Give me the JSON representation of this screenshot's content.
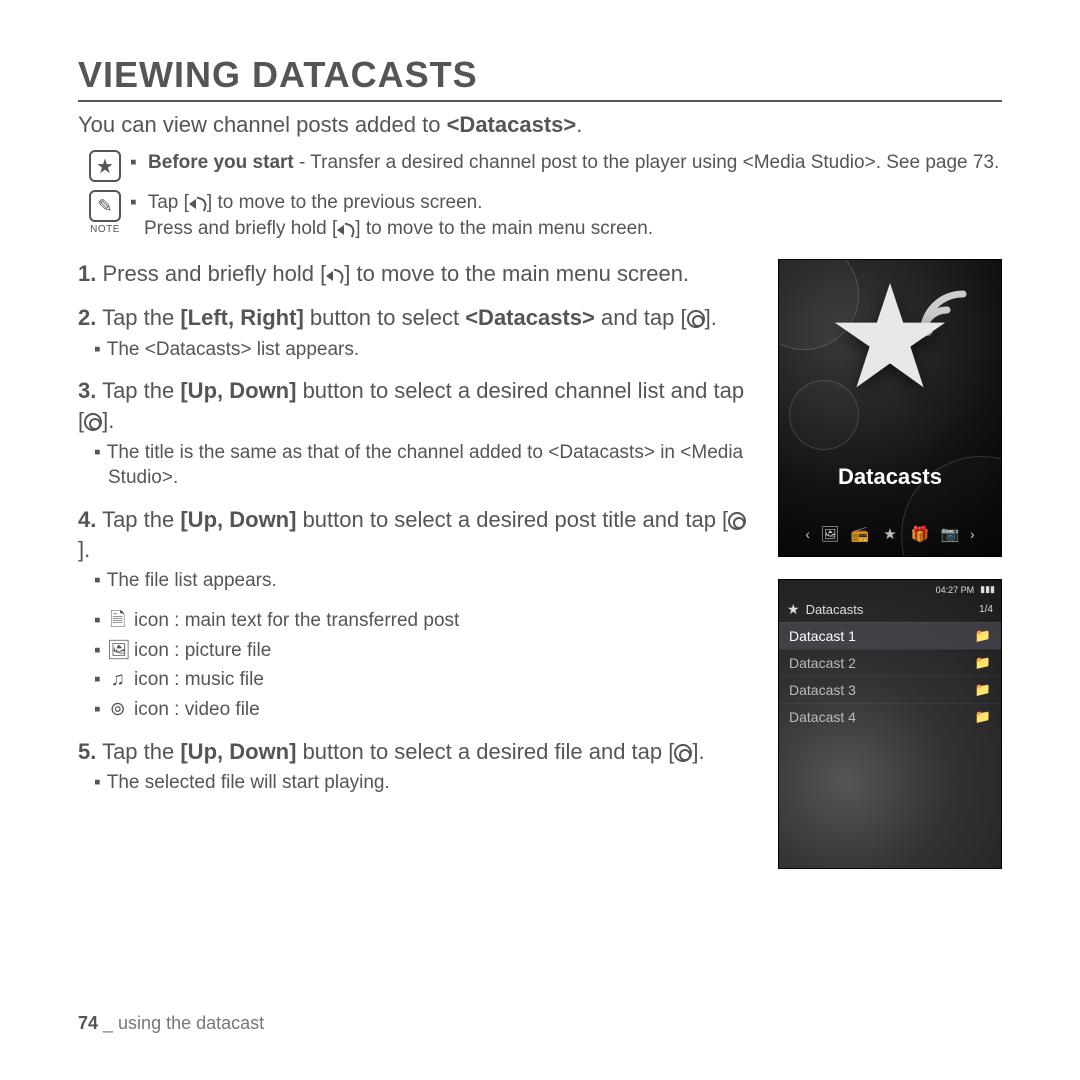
{
  "title": "VIEWING DATACASTS",
  "intro_pre": "You can view channel posts added to ",
  "intro_bold": "<Datacasts>",
  "intro_post": ".",
  "callouts": {
    "before_bold": "Before you start",
    "before_rest": " - Transfer a desired channel post to the player using <Media Studio>. See page 73.",
    "note_label": "NOTE",
    "note_line1a": "Tap [",
    "note_line1b": "] to move to the previous screen.",
    "note_line2a": "Press and briefly hold [",
    "note_line2b": "] to move to the main menu screen."
  },
  "steps": {
    "s1_num": "1.",
    "s1_a": " Press and briefly hold [",
    "s1_b": "] to move to the main menu screen.",
    "s2_num": "2.",
    "s2_a": " Tap the ",
    "s2_bold": "[Left, Right]",
    "s2_b": " button to select ",
    "s2_bold2": "<Datacasts>",
    "s2_c": " and tap [",
    "s2_d": "].",
    "s2_sub": "The <Datacasts> list appears.",
    "s3_num": "3.",
    "s3_a": " Tap the ",
    "s3_bold": "[Up, Down]",
    "s3_b": " button to select a desired channel list and tap [",
    "s3_c": "].",
    "s3_sub": "The title is the same as that of the channel added to <Datacasts> in <Media Studio>.",
    "s4_num": "4.",
    "s4_a": " Tap the ",
    "s4_bold": "[Up, Down]",
    "s4_b": " button to select a desired post title and tap [",
    "s4_c": "].",
    "s4_sub": "The file list appears.",
    "icon_text": "icon : main text for the transferred post",
    "icon_pic": "icon : picture file",
    "icon_music": "icon : music file",
    "icon_video": "icon : video file",
    "s5_num": "5.",
    "s5_a": " Tap the ",
    "s5_bold": "[Up, Down]",
    "s5_b": " button to select a desired file and tap [",
    "s5_c": "].",
    "s5_sub": "The selected file will start playing."
  },
  "device1": {
    "label": "Datacasts"
  },
  "device2": {
    "time": "04:27 PM",
    "title": "Datacasts",
    "count": "1/4",
    "items": [
      "Datacast 1",
      "Datacast 2",
      "Datacast 3",
      "Datacast 4"
    ]
  },
  "footer": {
    "page": "74",
    "sep": " _ ",
    "section": "using the datacast"
  }
}
